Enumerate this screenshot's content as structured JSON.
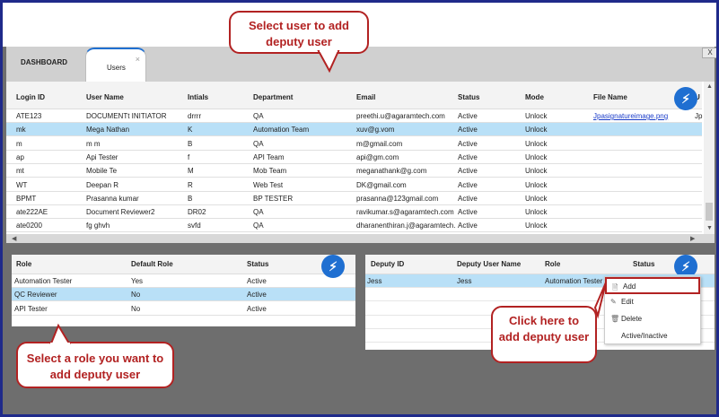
{
  "tabs": {
    "dashboard": "DASHBOARD",
    "users": "Users",
    "tab_close": "×",
    "window_close": "X"
  },
  "users_grid": {
    "columns": [
      "Login ID",
      "User Name",
      "Intials",
      "Department",
      "Email",
      "Status",
      "Mode",
      "File Name",
      "U"
    ],
    "rows": [
      [
        "ATE123",
        "DOCUMENTt INITIATOR",
        "drrrr",
        "QA",
        "preethi.u@agaramtech.com",
        "Active",
        "Unlock",
        "Jpasignatureimage.png",
        "Jp"
      ],
      [
        "mk",
        "Mega Nathan",
        "K",
        "Automation Team",
        "xuv@g.vom",
        "Active",
        "Unlock",
        "",
        ""
      ],
      [
        "m",
        "m m",
        "B",
        "QA",
        "m@gmail.com",
        "Active",
        "Unlock",
        "",
        ""
      ],
      [
        "ap",
        "Api Tester",
        "f",
        "API Team",
        "api@gm.com",
        "Active",
        "Unlock",
        "",
        ""
      ],
      [
        "mt",
        "Mobile Te",
        "M",
        "Mob Team",
        "meganathank@g.com",
        "Active",
        "Unlock",
        "",
        ""
      ],
      [
        "WT",
        "Deepan R",
        "R",
        "Web Test",
        "DK@gmail.com",
        "Active",
        "Unlock",
        "",
        ""
      ],
      [
        "BPMT",
        "Prasanna kumar",
        "B",
        "BP TESTER",
        "prasanna@123gmail.com",
        "Active",
        "Unlock",
        "",
        ""
      ],
      [
        "ate222AE",
        "Document Reviewer2",
        "DR02",
        "QA",
        "ravikumar.s@agaramtech.com",
        "Active",
        "Unlock",
        "",
        ""
      ],
      [
        "ate0200",
        "fg ghvh",
        "svfd",
        "QA",
        "dharanenthiran.j@agaramtech.com",
        "Active",
        "Unlock",
        "",
        ""
      ]
    ],
    "selected_row": 1
  },
  "role_grid": {
    "columns": [
      "Role",
      "Default Role",
      "Status"
    ],
    "rows": [
      [
        "Automation Tester",
        "Yes",
        "Active"
      ],
      [
        "QC Reviewer",
        "No",
        "Active"
      ],
      [
        "API Tester",
        "No",
        "Active"
      ]
    ],
    "selected_row": 1
  },
  "deputy_grid": {
    "columns": [
      "Deputy ID",
      "Deputy User Name",
      "Role",
      "Status"
    ],
    "rows": [
      [
        "Jess",
        "Jess",
        "Automation Tester",
        ""
      ]
    ],
    "selected_row": 0
  },
  "context_menu": {
    "items": [
      {
        "label": "Add",
        "icon": "document-icon"
      },
      {
        "label": "Edit",
        "icon": "edit-icon"
      },
      {
        "label": "Delete",
        "icon": "trash-icon"
      },
      {
        "label": "Active/Inactive",
        "icon": ""
      }
    ],
    "highlighted": "Add"
  },
  "callouts": {
    "select_user": "Select user to add deputy user",
    "select_role": "Select a role you want to add deputy user",
    "click_here": "Click here to add deputy user"
  },
  "colors": {
    "accent": "#1f6fd1",
    "selection": "#b9e0f7",
    "callout": "#b22222",
    "frame": "#1f2a8a"
  },
  "icons": {
    "action": "lightning-icon"
  }
}
